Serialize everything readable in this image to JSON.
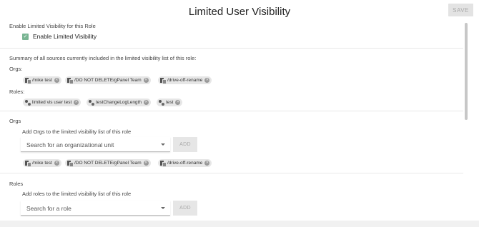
{
  "header": {
    "title": "Limited User Visibility",
    "save_label": "SAVE"
  },
  "enable_section": {
    "heading": "Enable Limited Visibility for this Role",
    "checkbox_label": "Enable Limited Visibility",
    "checked": true
  },
  "summary": {
    "heading": "Summary of all sources currently included in the limited visibility list of this role:",
    "orgs_label": "Orgs:",
    "orgs": [
      "/mike test",
      "/DO NOT DELETE/gPanel Team",
      "/drive-off-rename"
    ],
    "roles_label": "Roles:",
    "roles": [
      "limited vis user test",
      "testChangeLogLength",
      "test"
    ]
  },
  "orgs_section": {
    "title": "Orgs",
    "instruction": "Add Orgs to the limited visibility list of this role",
    "placeholder": "Search for an organizational unit",
    "add_label": "ADD",
    "items": [
      "/mike test",
      "/DO NOT DELETE/gPanel Team",
      "/drive-off-rename"
    ]
  },
  "roles_section": {
    "title": "Roles",
    "instruction": "Add roles to the limited visibility list of this role",
    "placeholder": "Search for a role",
    "add_label": "ADD"
  },
  "colors": {
    "checkbox": "#79b593",
    "chip_bg": "#e6e6e6",
    "disabled_button": "#e3e3e3"
  },
  "icons": {
    "org": "org-unit-icon",
    "role": "role-icon",
    "remove": "remove-chip-icon",
    "dropdown": "chevron-down-icon"
  }
}
